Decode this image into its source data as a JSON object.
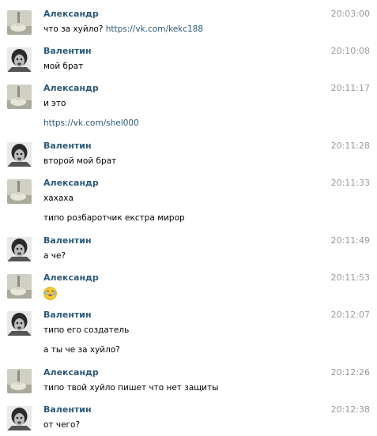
{
  "messages": [
    {
      "author": "Александр",
      "avatar": "alexandr-avatar",
      "time": "20:03:00",
      "lines": [
        {
          "prefix": "что за хуйло? ",
          "link": "https://vk.com/kekc188"
        }
      ]
    },
    {
      "author": "Валентин",
      "avatar": "valentin-avatar",
      "time": "20:10:08",
      "lines": [
        {
          "text": "мой брат"
        }
      ]
    },
    {
      "author": "Александр",
      "avatar": "alexandr-avatar",
      "time": "20:11:17",
      "lines": [
        {
          "text": "и это"
        },
        {
          "link": "https://vk.com/shel000"
        }
      ]
    },
    {
      "author": "Валентин",
      "avatar": "valentin-avatar",
      "time": "20:11:28",
      "lines": [
        {
          "text": "второй мой брат"
        }
      ]
    },
    {
      "author": "Александр",
      "avatar": "alexandr-avatar",
      "time": "20:11:33",
      "lines": [
        {
          "text": "хахаха"
        },
        {
          "text": "типо розбаротчик екстра мирор"
        }
      ]
    },
    {
      "author": "Валентин",
      "avatar": "valentin-avatar",
      "time": "20:11:49",
      "lines": [
        {
          "text": "а че?"
        }
      ]
    },
    {
      "author": "Александр",
      "avatar": "alexandr-avatar",
      "time": "20:11:53",
      "lines": [
        {
          "emoji": "laughing-with-tears-emoji"
        }
      ]
    },
    {
      "author": "Валентин",
      "avatar": "valentin-avatar",
      "time": "20:12:07",
      "lines": [
        {
          "text": "типо его создатель"
        },
        {
          "text": "а ты че за хуйло?"
        }
      ]
    },
    {
      "author": "Александр",
      "avatar": "alexandr-avatar",
      "time": "20:12:26",
      "lines": [
        {
          "text": "типо твой хуйло пишет что нет защиты"
        }
      ]
    },
    {
      "author": "Валентин",
      "avatar": "valentin-avatar",
      "time": "20:12:38",
      "lines": [
        {
          "text": "от чего?"
        }
      ]
    }
  ],
  "colors": {
    "author": "#2b587a",
    "link": "#2b587a",
    "time": "#999999",
    "text": "#000000"
  }
}
